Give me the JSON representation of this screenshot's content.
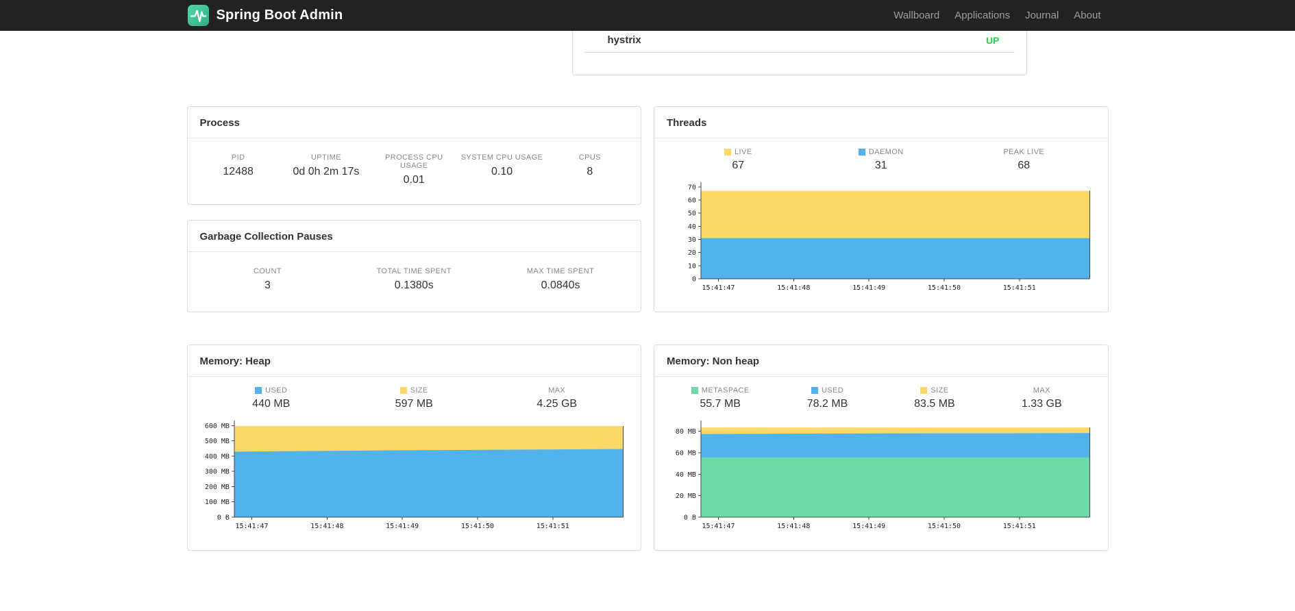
{
  "navbar": {
    "brand": "Spring Boot Admin",
    "links": [
      {
        "label": "Wallboard"
      },
      {
        "label": "Applications"
      },
      {
        "label": "Journal"
      },
      {
        "label": "About"
      }
    ]
  },
  "status_panel": {
    "app_name": "hystrix",
    "status": "UP",
    "status_color": "#2BD34B"
  },
  "panels": {
    "process": {
      "title": "Process",
      "metrics": [
        {
          "label": "PID",
          "value": "12488"
        },
        {
          "label": "UPTIME",
          "value": "0d 0h 2m 17s"
        },
        {
          "label": "PROCESS CPU USAGE",
          "value": "0.01"
        },
        {
          "label": "SYSTEM CPU USAGE",
          "value": "0.10"
        },
        {
          "label": "CPUS",
          "value": "8"
        }
      ]
    },
    "gc": {
      "title": "Garbage Collection Pauses",
      "metrics": [
        {
          "label": "COUNT",
          "value": "3"
        },
        {
          "label": "TOTAL TIME SPENT",
          "value": "0.1380s"
        },
        {
          "label": "MAX TIME SPENT",
          "value": "0.0840s"
        }
      ]
    },
    "threads": {
      "title": "Threads",
      "legend": [
        {
          "label": "LIVE",
          "value": "67",
          "color": "#FBD868"
        },
        {
          "label": "DAEMON",
          "value": "31",
          "color": "#51B2EC"
        },
        {
          "label": "PEAK LIVE",
          "value": "68",
          "color": null
        }
      ]
    },
    "heap": {
      "title": "Memory: Heap",
      "legend": [
        {
          "label": "USED",
          "value": "440 MB",
          "color": "#51B2EC"
        },
        {
          "label": "SIZE",
          "value": "597 MB",
          "color": "#FBD868"
        },
        {
          "label": "MAX",
          "value": "4.25 GB",
          "color": null
        }
      ]
    },
    "nonheap": {
      "title": "Memory: Non heap",
      "legend": [
        {
          "label": "METASPACE",
          "value": "55.7 MB",
          "color": "#6FD8A8"
        },
        {
          "label": "USED",
          "value": "78.2 MB",
          "color": "#51B2EC"
        },
        {
          "label": "SIZE",
          "value": "83.5 MB",
          "color": "#FBD868"
        },
        {
          "label": "MAX",
          "value": "1.33 GB",
          "color": null
        }
      ]
    }
  },
  "chart_data": [
    {
      "id": "threads",
      "type": "area",
      "title": "Threads",
      "x_labels": [
        "15:41:47",
        "15:41:48",
        "15:41:49",
        "15:41:50",
        "15:41:51"
      ],
      "ylim": [
        0,
        72
      ],
      "y_tick_values": [
        0,
        10,
        20,
        30,
        40,
        50,
        60,
        70
      ],
      "y_tick_labels": [
        "0",
        "10",
        "20",
        "30",
        "40",
        "50",
        "60",
        "70"
      ],
      "series": [
        {
          "name": "LIVE",
          "color": "#FBD868",
          "values": [
            67,
            67,
            67,
            67,
            67,
            67
          ]
        },
        {
          "name": "DAEMON",
          "color": "#51B2EC",
          "values": [
            31,
            31,
            31,
            31,
            31,
            31
          ]
        }
      ]
    },
    {
      "id": "memory-heap",
      "type": "area",
      "title": "Memory: Heap",
      "x_labels": [
        "15:41:47",
        "15:41:48",
        "15:41:49",
        "15:41:50",
        "15:41:51"
      ],
      "ylim": [
        0,
        620
      ],
      "y_tick_values": [
        0,
        100,
        200,
        300,
        400,
        500,
        600
      ],
      "y_tick_labels": [
        "0 B",
        "100 MB",
        "200 MB",
        "300 MB",
        "400 MB",
        "500 MB",
        "600 MB"
      ],
      "series": [
        {
          "name": "SIZE",
          "color": "#FBD868",
          "values": [
            597,
            597,
            597,
            597,
            597,
            597
          ]
        },
        {
          "name": "USED",
          "color": "#51B2EC",
          "values": [
            430,
            434,
            438,
            441,
            444,
            447
          ]
        }
      ]
    },
    {
      "id": "memory-nonheap",
      "type": "area",
      "title": "Memory: Non heap",
      "x_labels": [
        "15:41:47",
        "15:41:48",
        "15:41:49",
        "15:41:50",
        "15:41:51"
      ],
      "ylim": [
        0,
        88
      ],
      "y_tick_values": [
        0,
        20,
        40,
        60,
        80
      ],
      "y_tick_labels": [
        "0 B",
        "20 MB",
        "40 MB",
        "60 MB",
        "80 MB"
      ],
      "series": [
        {
          "name": "SIZE",
          "color": "#FBD868",
          "values": [
            83.5,
            83.5,
            83.5,
            83.5,
            83.5,
            83.5
          ]
        },
        {
          "name": "USED",
          "color": "#51B2EC",
          "values": [
            77.4,
            77.7,
            77.9,
            78.1,
            78.2,
            78.3
          ]
        },
        {
          "name": "METASPACE",
          "color": "#6FD8A8",
          "values": [
            55.7,
            55.7,
            55.7,
            55.7,
            55.7,
            55.7
          ]
        }
      ]
    }
  ]
}
